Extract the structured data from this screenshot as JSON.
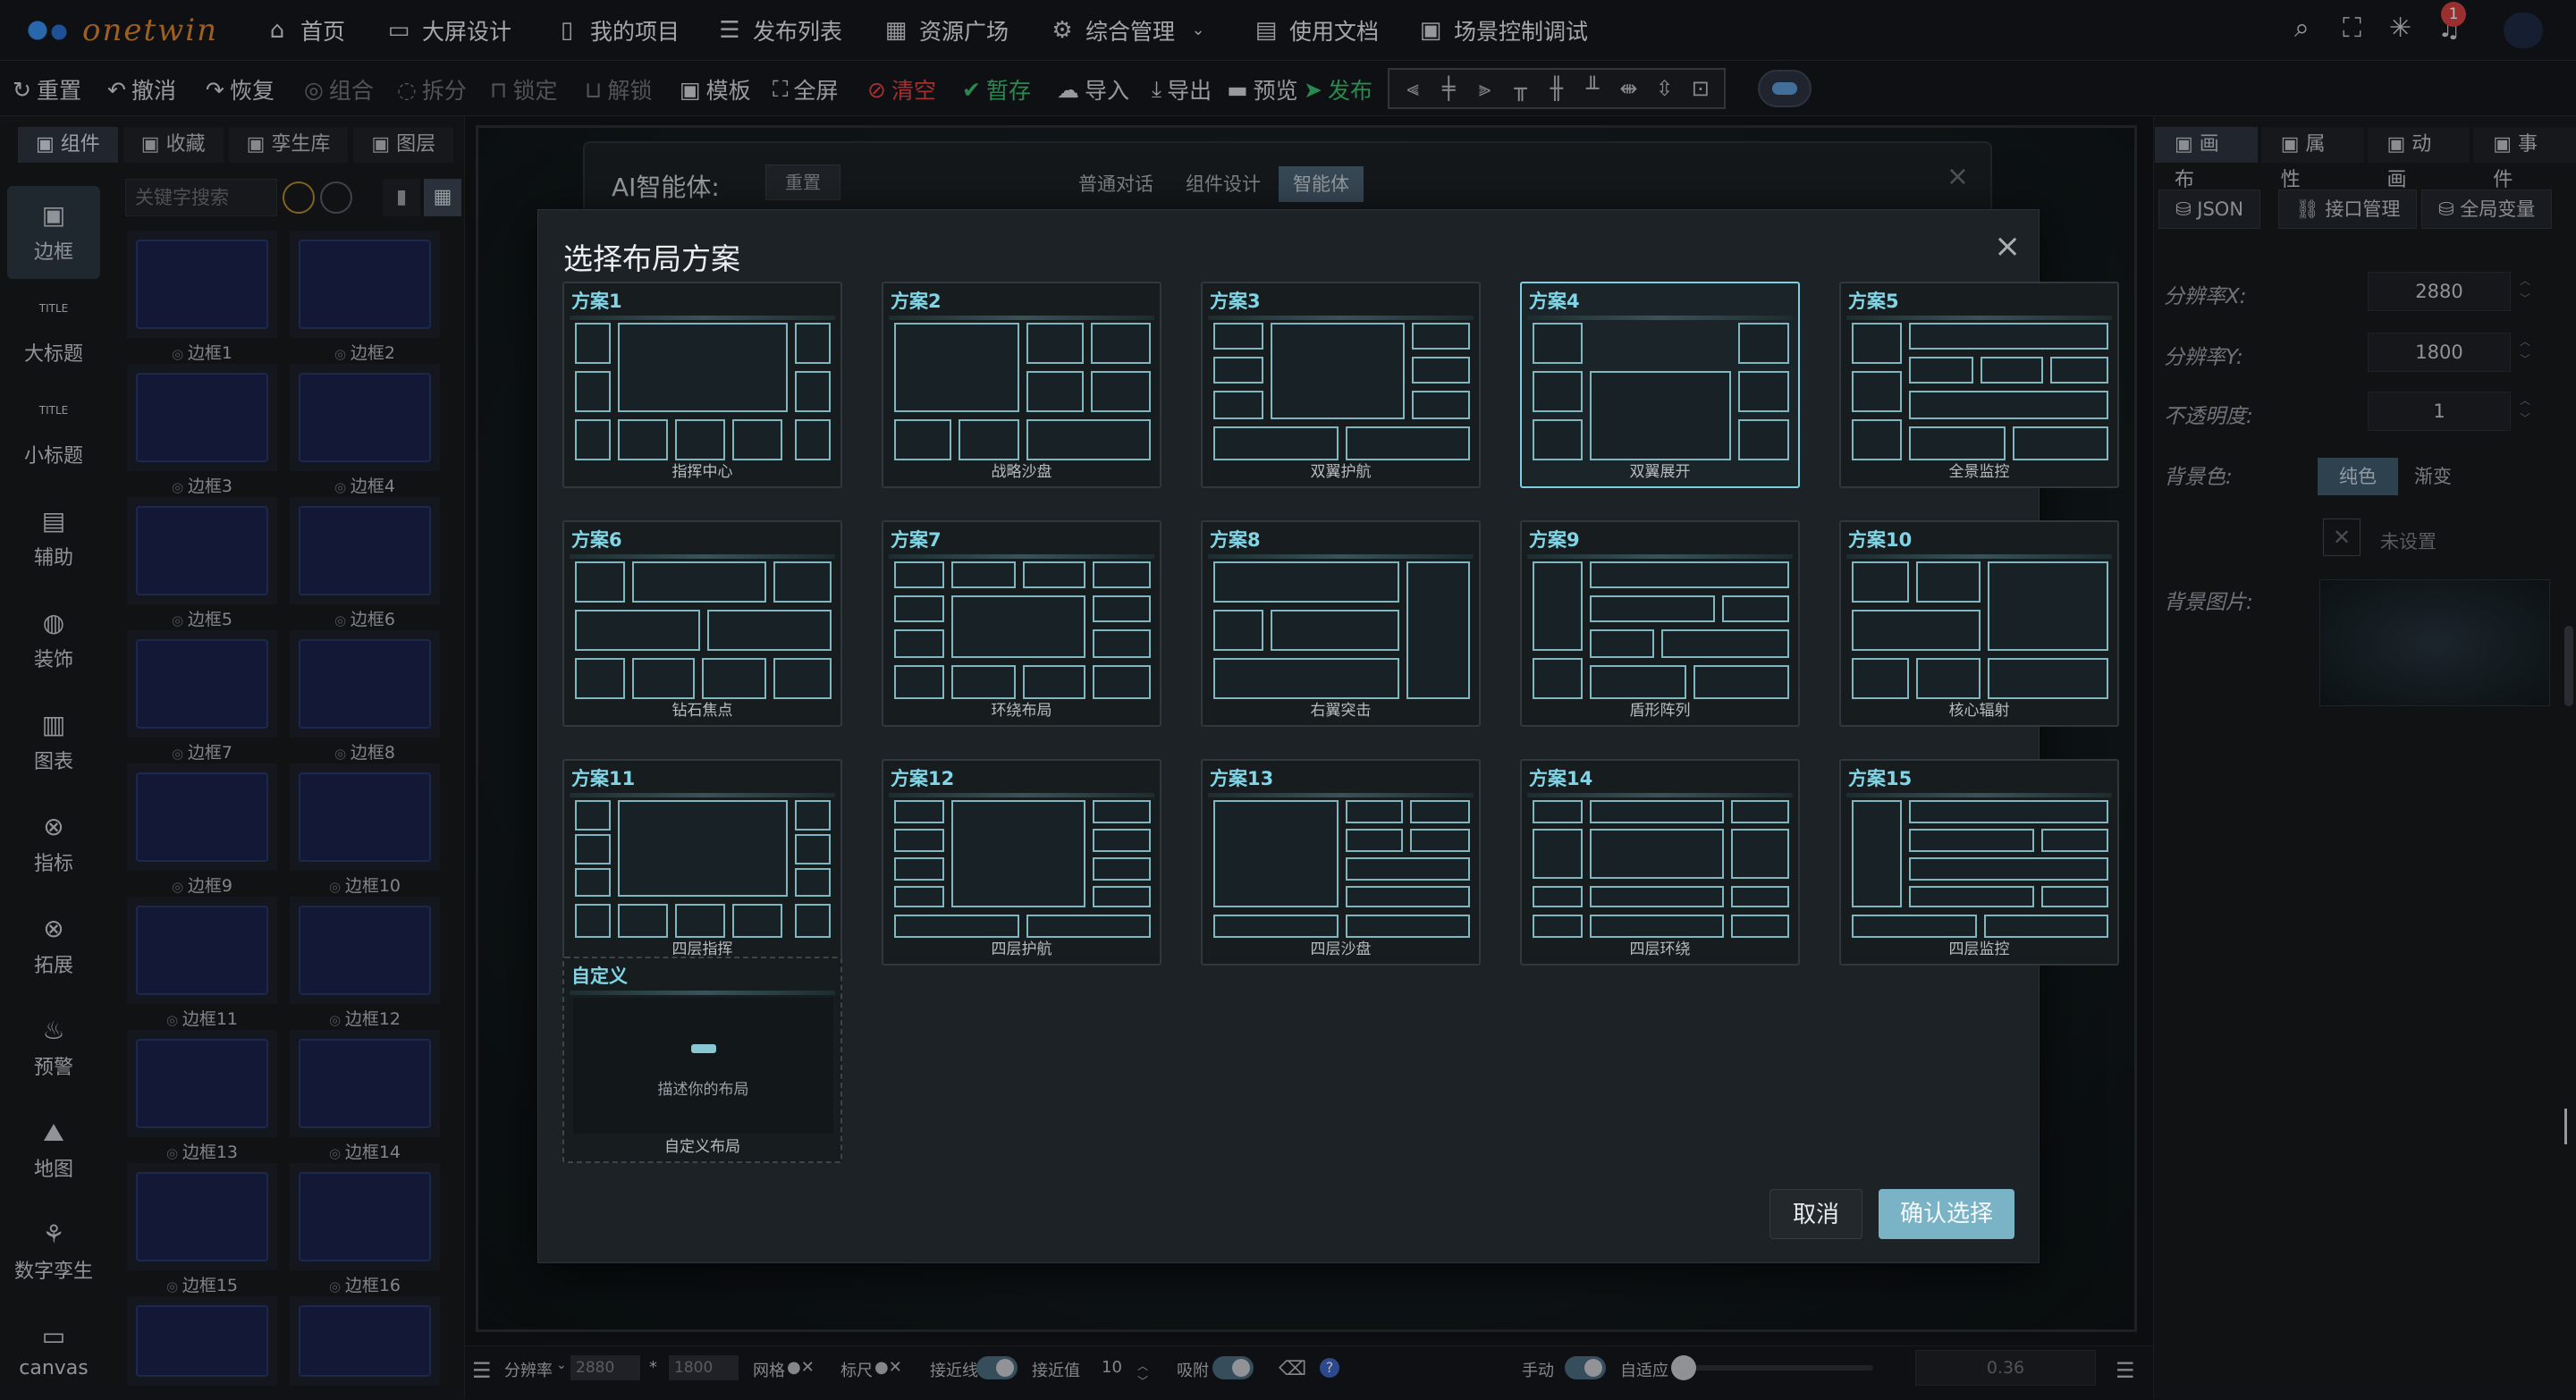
{
  "app": {
    "logo_text": "onetwin",
    "nav": [
      "首页",
      "大屏设计",
      "我的项目",
      "发布列表",
      "资源广场",
      "综合管理",
      "使用文档",
      "场景控制调试"
    ],
    "notification_count": "1"
  },
  "toolbar": {
    "items": [
      "重置",
      "撤消",
      "恢复",
      "组合",
      "拆分",
      "锁定",
      "解锁",
      "模板",
      "全屏",
      "清空",
      "暂存",
      "导入",
      "导出",
      "预览",
      "发布"
    ]
  },
  "left": {
    "tabs": [
      "组件",
      "收藏",
      "孪生库",
      "图层"
    ],
    "search_placeholder": "关键字搜索",
    "vnav": [
      "边框",
      "大标题",
      "小标题",
      "辅助",
      "装饰",
      "图表",
      "指标",
      "拓展",
      "预警",
      "地图",
      "数字孪生",
      "canvas"
    ],
    "vnav_small": [
      "TITLE",
      "TITLE"
    ],
    "thumbs": [
      "边框1",
      "边框2",
      "边框3",
      "边框4",
      "边框5",
      "边框6",
      "边框7",
      "边框8",
      "边框9",
      "边框10",
      "边框11",
      "边框12",
      "边框13",
      "边框14",
      "边框15",
      "边框16"
    ]
  },
  "ai_panel": {
    "title": "AI智能体:",
    "reset": "重置",
    "segments": [
      "普通对话",
      "组件设计",
      "智能体"
    ]
  },
  "modal": {
    "title": "选择布局方案",
    "cards": [
      {
        "name": "方案1",
        "label": "指挥中心"
      },
      {
        "name": "方案2",
        "label": "战略沙盘"
      },
      {
        "name": "方案3",
        "label": "双翼护航"
      },
      {
        "name": "方案4",
        "label": "双翼展开"
      },
      {
        "name": "方案5",
        "label": "全景监控"
      },
      {
        "name": "方案6",
        "label": "钻石焦点"
      },
      {
        "name": "方案7",
        "label": "环绕布局"
      },
      {
        "name": "方案8",
        "label": "右翼突击"
      },
      {
        "name": "方案9",
        "label": "盾形阵列"
      },
      {
        "name": "方案10",
        "label": "核心辐射"
      },
      {
        "name": "方案11",
        "label": "四层指挥"
      },
      {
        "name": "方案12",
        "label": "四层护航"
      },
      {
        "name": "方案13",
        "label": "四层沙盘"
      },
      {
        "name": "方案14",
        "label": "四层环绕"
      },
      {
        "name": "方案15",
        "label": "四层监控"
      }
    ],
    "selected_card": "方案4",
    "custom": {
      "name": "自定义",
      "hint": "描述你的布局",
      "label": "自定义布局"
    },
    "cancel": "取消",
    "confirm": "确认选择"
  },
  "right": {
    "tabs": [
      "画布",
      "属性",
      "动画",
      "事件"
    ],
    "buttons": [
      "JSON",
      "接口管理",
      "全局变量"
    ],
    "res_x_label": "分辨率X:",
    "res_x": "2880",
    "res_y_label": "分辨率Y:",
    "res_y": "1800",
    "opacity_label": "不透明度:",
    "opacity": "1",
    "bg_color_label": "背景色:",
    "bg_modes": [
      "纯色",
      "渐变"
    ],
    "unset": "未设置",
    "bg_image_label": "背景图片:"
  },
  "bottom": {
    "resolution_label": "分辨率",
    "res_w": "2880",
    "res_h": "1800",
    "grid": "网格",
    "ruler": "标尺",
    "snapline": "接近线",
    "snapval_label": "接近值",
    "snapval": "10",
    "adsorb": "吸附",
    "manual": "手动",
    "adaptive": "自适应",
    "zoom": "0.36"
  }
}
